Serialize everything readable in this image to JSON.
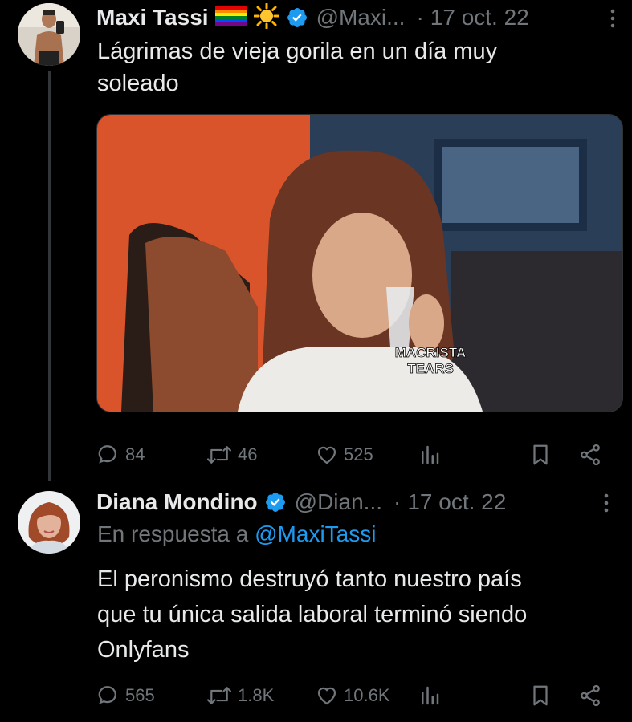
{
  "tweet1": {
    "display_name": "Maxi Tassi",
    "emojis": "🏳️‍🌈☀️",
    "handle": "@Maxi...",
    "separator": "·",
    "date": "17 oct. 22",
    "text_line1": "Lágrimas de vieja gorila en un día muy",
    "text_line2": "soleado",
    "media_caption_line1": "MACRISTA",
    "media_caption_line2": "TEARS",
    "replies": "84",
    "retweets": "46",
    "likes": "525"
  },
  "tweet2": {
    "display_name": "Diana Mondino",
    "handle": "@Dian...",
    "separator": "·",
    "date": "17 oct. 22",
    "replying_prefix": "En respuesta a",
    "replying_mention": "@MaxiTassi",
    "text_line1": "El peronismo destruyó tanto nuestro país",
    "text_line2": "que tu única salida laboral terminó siendo",
    "text_line3": "Onlyfans",
    "replies": "565",
    "retweets": "1.8K",
    "likes": "10.6K"
  },
  "colors": {
    "background": "#000000",
    "text_primary": "#e7e9ea",
    "text_secondary": "#71767b",
    "accent": "#1d9bf0"
  },
  "icons": [
    "reply-icon",
    "retweet-icon",
    "like-icon",
    "views-icon",
    "bookmark-icon",
    "share-icon",
    "verified-badge-icon",
    "more-icon"
  ]
}
